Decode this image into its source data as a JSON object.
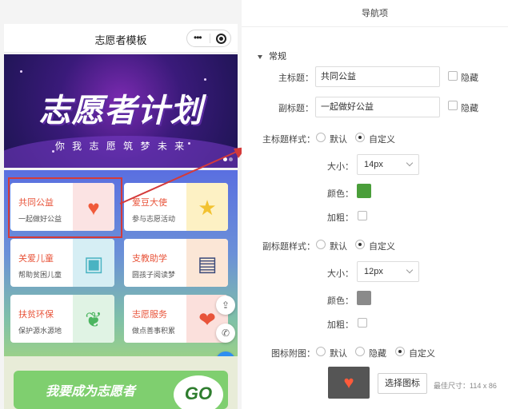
{
  "phone": {
    "title": "志愿者模板",
    "capsule_dots": "•••",
    "banner": {
      "title": "志愿者计划",
      "subtitle": "你 我 志 愿 筑 梦 未 来"
    },
    "cards": [
      {
        "title": "共同公益",
        "subtitle": "一起做好公益",
        "icon": "heart-icon",
        "title_color": "#e8543a"
      },
      {
        "title": "爱豆大使",
        "subtitle": "参与志愿活动",
        "icon": "star-icon",
        "title_color": "#e8543a"
      },
      {
        "title": "关爱儿童",
        "subtitle": "帮助贫困儿童",
        "icon": "bag-icon",
        "title_color": "#e8543a"
      },
      {
        "title": "支教助学",
        "subtitle": "圆孩子阅读梦",
        "icon": "book-icon",
        "title_color": "#e8543a"
      },
      {
        "title": "扶贫环保",
        "subtitle": "保护源水源地",
        "icon": "leaf-icon",
        "title_color": "#e8543a"
      },
      {
        "title": "志愿服务",
        "subtitle": "做点善事积累",
        "icon": "heart-hand-icon",
        "title_color": "#e8543a"
      }
    ],
    "join_text": "我要成为志愿者",
    "go_text": "GO"
  },
  "panel": {
    "header": "导航项",
    "section": "常规",
    "main_title": {
      "label": "主标题：",
      "value": "共同公益",
      "hide_label": "隐藏"
    },
    "sub_title": {
      "label": "副标题：",
      "value": "一起做好公益",
      "hide_label": "隐藏"
    },
    "main_style": {
      "label": "主标题样式：",
      "options": [
        "默认",
        "自定义"
      ],
      "selected": "自定义",
      "size_label": "大小：",
      "size_value": "14px",
      "color_label": "颜色：",
      "color": "#4a9e3a",
      "bold_label": "加粗："
    },
    "sub_style": {
      "label": "副标题样式：",
      "options": [
        "默认",
        "自定义"
      ],
      "selected": "自定义",
      "size_label": "大小：",
      "size_value": "12px",
      "color_label": "颜色：",
      "color": "#8a8a8a",
      "bold_label": "加粗："
    },
    "icon_image": {
      "label": "图标附图：",
      "options": [
        "默认",
        "隐藏",
        "自定义"
      ],
      "selected": "自定义",
      "select_button": "选择图标",
      "hint": "最佳尺寸：114 x 86"
    }
  },
  "colors": {
    "highlight": "#d43a3a",
    "accent_blue": "#2f8ef0"
  }
}
